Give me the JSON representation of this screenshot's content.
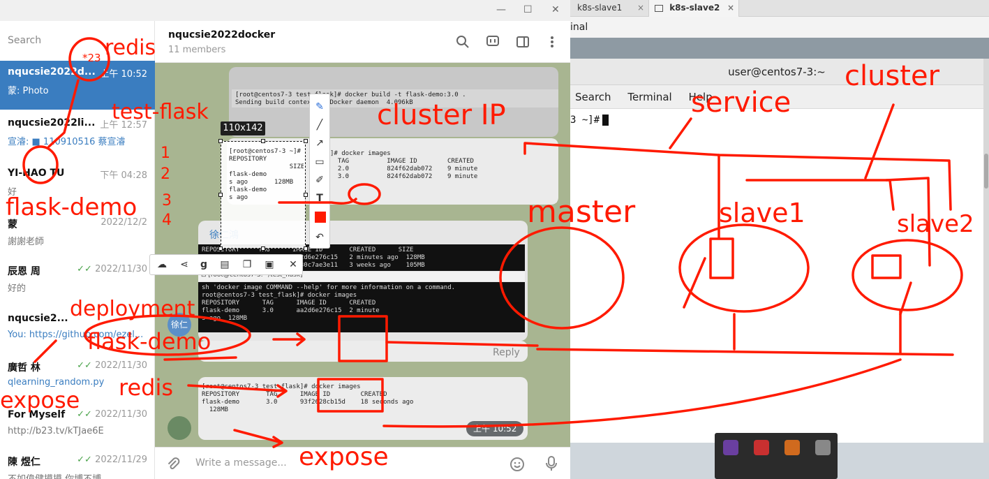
{
  "terminal": {
    "tabs": [
      {
        "label": "k8s-slave1",
        "close": "×"
      },
      {
        "label": "k8s-slave2",
        "close": "×"
      }
    ],
    "subtab_label": "inal",
    "window_title": "user@centos7-3:~",
    "menu": [
      "Search",
      "Terminal",
      "Help"
    ],
    "prompt": "3 ~]#"
  },
  "telegram": {
    "search_placeholder": "Search",
    "group_title": "nqucsie2022docker",
    "group_members": "11 members",
    "chats": [
      {
        "name": "nqucsie2022d...",
        "time": "上午 10:52",
        "preview": "蒙: Photo"
      },
      {
        "name": "nqucsie2022li...",
        "time": "上午 12:57",
        "preview": "宣濬: ■ 110910516 蔡宣濬"
      },
      {
        "name": "YI-HAO TU",
        "time": "下午 04:28",
        "preview": "好"
      },
      {
        "name": "蒙",
        "time": "2022/12/2",
        "preview": "謝謝老師"
      },
      {
        "name": "辰恩 周",
        "time": "2022/11/30",
        "preview": "好的"
      },
      {
        "name": "nqucsie2...",
        "time": "",
        "preview": "You: https://github.com/ezel..."
      },
      {
        "name": "廣哲 林",
        "time": "2022/11/30",
        "preview": "qlearning_random.py"
      },
      {
        "name": "For Myself",
        "time": "2022/11/30",
        "preview": "http://b23.tv/kTJae6E"
      },
      {
        "name": "陳 煜仁",
        "time": "2022/11/29",
        "preview": "不如偉健摸摸 你博不博 ..."
      }
    ],
    "sender_name": "徐仁鴻",
    "avatar_label": "徐仁",
    "reply_label": "Reply",
    "message_time": "上午 10:52",
    "compose_placeholder": "Write a message...",
    "shots": {
      "build_cmd": "[root@centos7-3 test_flask]# docker build -t flask-demo:3.0 .\nSending build context to Docker daemon  4.096kB",
      "images_table": "]# docker images\n  TAG          IMAGE ID        CREATED\n  2.0          824f62dab072    9 minute\n  3.0          824f62dab072    9 minute",
      "mid_table": "REPOSITORY     TAG      IMAGE ID       CREATED      SIZE\nflask-demo     3.0      aa2d6e276c15   2 minutes ago  128MB\nredis          6.2.6    0830c7ae3e11   3 weeks ago    105MB",
      "dark_table": "sh 'docker image COMMAND --help' for more information on a command.\nroot@centos7-3 test_flask]# docker images\nREPOSITORY      TAG      IMAGE ID      CREATED\nflask-demo      3.0      aa2d6e276c15  2 minute\ns ago  128MB",
      "bottom_table": "[root@centos7-3 test_flask]# docker images\nREPOSITORY       TAG      IMAGE ID        CREATED\nflask-demo       3.0      93f2628cb15d    18 seconds ago\n  128MB",
      "selected_table": "[root@centos7-3 ~]#\nREPOSITORY\n                SIZE\nflask-demo\ns ago       128MB\nflask-demo\ns ago"
    }
  },
  "snip_tool": {
    "size_label": "110x142"
  },
  "ink": {
    "color": "#ff1a00",
    "words": [
      "redis",
      "test-flask",
      "cluster IP",
      "flask-demo",
      "deployment",
      "flask-demo",
      "expose",
      "redis",
      "expose",
      "service",
      "cluster",
      "master",
      "slave1",
      "slave2"
    ],
    "list_numbers": [
      "1",
      "2",
      "3",
      "4"
    ],
    "badge": "*23"
  }
}
